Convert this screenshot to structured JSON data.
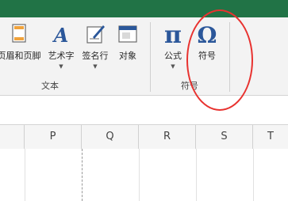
{
  "ribbon": {
    "buttons": {
      "header_footer": "页眉和页脚",
      "wordart": "艺术字",
      "signature_line": "签名行",
      "object": "对象",
      "equation": "公式",
      "symbol": "符号"
    },
    "groups": {
      "text": "文本",
      "symbols": "符号"
    },
    "equation_glyph": "π",
    "symbol_glyph": "Ω",
    "wordart_glyph": "A"
  },
  "sheet": {
    "columns": [
      "P",
      "Q",
      "R",
      "S",
      "T"
    ]
  },
  "colors": {
    "title_bar": "#217346",
    "accent_blue": "#2b579a",
    "annotation_red": "#e8322f"
  }
}
